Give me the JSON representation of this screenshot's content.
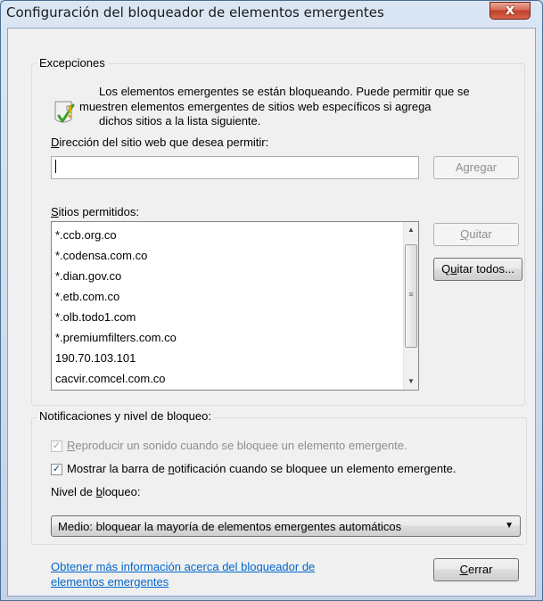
{
  "window": {
    "title": "Configuración del bloqueador de elementos emergentes",
    "close_glyph": "x"
  },
  "exceptions": {
    "group_label": "Excepciones",
    "info_icon": "shield-warning-icon",
    "info_lines": [
      "Los elementos emergentes se están bloqueando. Puede permitir que se",
      "muestren elementos emergentes de sitios web específicos si agrega",
      "dichos sitios a la lista siguiente."
    ],
    "address_label_pre": "",
    "address_label_ul": "D",
    "address_label_post": "irección del sitio web que desea permitir:",
    "address_value": "",
    "add_button_pre": "Agre",
    "add_button_ul": "g",
    "add_button_post": "ar",
    "sites_label_ul": "S",
    "sites_label_post": "itios permitidos:",
    "sites": [
      "*.ccb.org.co",
      "*.codensa.com.co",
      "*.dian.gov.co",
      "*.etb.com.co",
      "*.olb.todo1.com",
      "*.premiumfilters.com.co",
      "190.70.103.101",
      "cacvir.comcel.com.co"
    ],
    "remove_button_ul": "Q",
    "remove_button_post": "uitar",
    "remove_all_button_pre": "Q",
    "remove_all_button_ul": "u",
    "remove_all_button_post": "itar todos..."
  },
  "notifications": {
    "group_label": "Notificaciones y nivel de bloqueo:",
    "sound_checked": true,
    "sound_ul": "R",
    "sound_post": "eproducir un sonido cuando se bloquee un elemento emergente.",
    "bar_checked": true,
    "bar_pre": "Mostrar la barra de ",
    "bar_ul": "n",
    "bar_post": "otificación cuando se bloquee un elemento emergente.",
    "level_label_pre": "Nivel de ",
    "level_label_ul": "b",
    "level_label_post": "loqueo:",
    "level_value": "Medio: bloquear la mayoría de elementos emergentes automáticos"
  },
  "footer": {
    "link_line1": "Obtener más información acerca del bloqueador de",
    "link_line2": "elementos emergentes",
    "close_ul": "C",
    "close_post": "errar"
  }
}
